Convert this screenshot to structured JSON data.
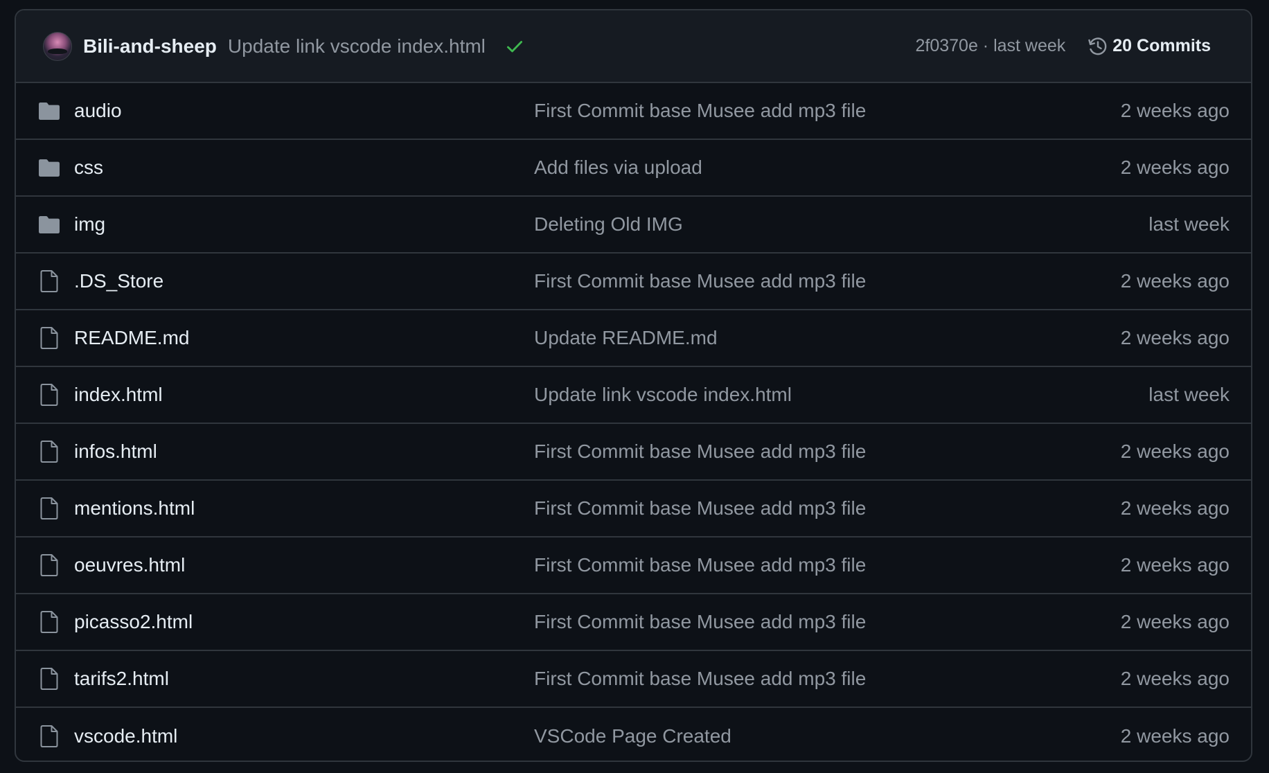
{
  "header": {
    "author": "Bili-and-sheep",
    "commit_message": "Update link vscode index.html",
    "status": "success",
    "status_icon": "check-icon",
    "sha_time": "2f0370e · last week",
    "commits_label": "20 Commits",
    "commits_icon": "history-icon"
  },
  "colors": {
    "background": "#0d1117",
    "header_bg": "#161b22",
    "border": "#30363d",
    "text": "#e6edf3",
    "muted": "#9198a1",
    "success": "#3fb950"
  },
  "files": [
    {
      "type": "directory",
      "icon": "folder-icon",
      "name": "audio",
      "message": "First Commit base Musee add mp3 file",
      "time": "2 weeks ago"
    },
    {
      "type": "directory",
      "icon": "folder-icon",
      "name": "css",
      "message": "Add files via upload",
      "time": "2 weeks ago"
    },
    {
      "type": "directory",
      "icon": "folder-icon",
      "name": "img",
      "message": "Deleting Old IMG",
      "time": "last week"
    },
    {
      "type": "file",
      "icon": "file-icon",
      "name": ".DS_Store",
      "message": "First Commit base Musee add mp3 file",
      "time": "2 weeks ago"
    },
    {
      "type": "file",
      "icon": "file-icon",
      "name": "README.md",
      "message": "Update README.md",
      "time": "2 weeks ago"
    },
    {
      "type": "file",
      "icon": "file-icon",
      "name": "index.html",
      "message": "Update link vscode index.html",
      "time": "last week"
    },
    {
      "type": "file",
      "icon": "file-icon",
      "name": "infos.html",
      "message": "First Commit base Musee add mp3 file",
      "time": "2 weeks ago"
    },
    {
      "type": "file",
      "icon": "file-icon",
      "name": "mentions.html",
      "message": "First Commit base Musee add mp3 file",
      "time": "2 weeks ago"
    },
    {
      "type": "file",
      "icon": "file-icon",
      "name": "oeuvres.html",
      "message": "First Commit base Musee add mp3 file",
      "time": "2 weeks ago"
    },
    {
      "type": "file",
      "icon": "file-icon",
      "name": "picasso2.html",
      "message": "First Commit base Musee add mp3 file",
      "time": "2 weeks ago"
    },
    {
      "type": "file",
      "icon": "file-icon",
      "name": "tarifs2.html",
      "message": "First Commit base Musee add mp3 file",
      "time": "2 weeks ago"
    },
    {
      "type": "file",
      "icon": "file-icon",
      "name": "vscode.html",
      "message": "VSCode Page Created",
      "time": "2 weeks ago"
    }
  ]
}
